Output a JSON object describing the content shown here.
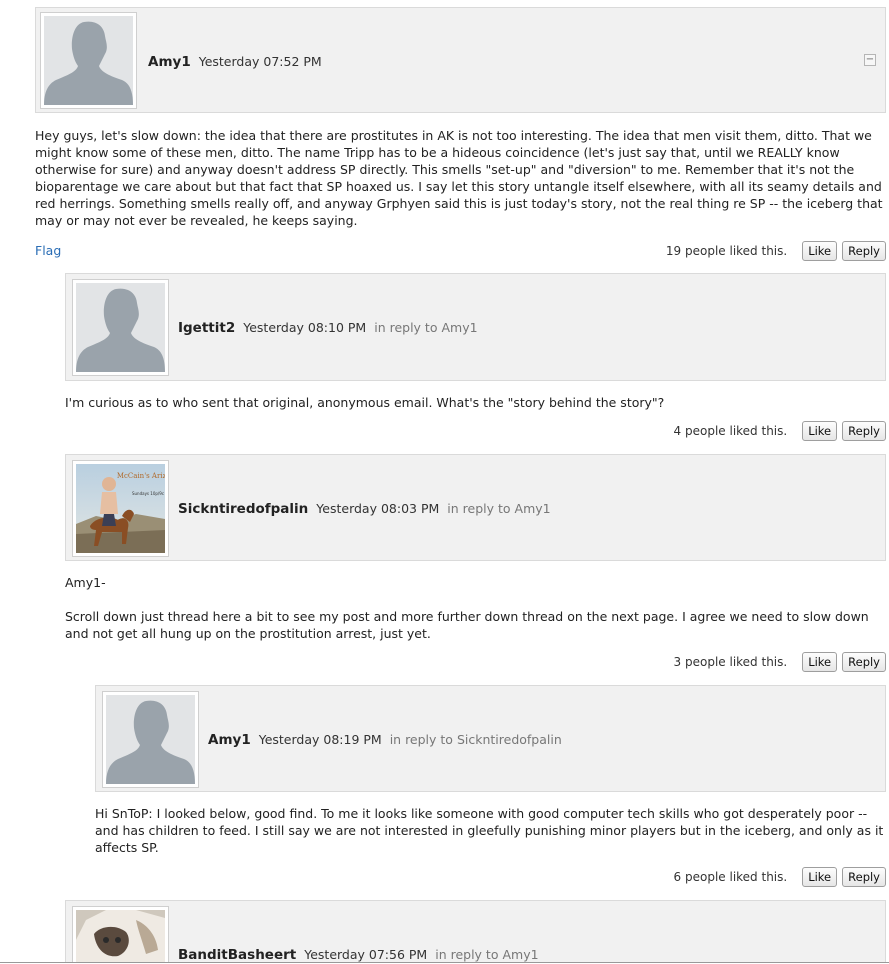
{
  "comments": [
    {
      "author": "Amy1",
      "time": "Yesterday 07:52 PM",
      "reply_to": "",
      "collapse_label": "−",
      "body": [
        "Hey guys, let's slow down: the idea that there are prostitutes in AK is not too interesting. The idea that men visit them, ditto. That we might know some of these men, ditto. The name Tripp has to be a hideous coincidence (let's just say that, until we REALLY know otherwise for sure) and anyway doesn't address SP directly. This smells \"set-up\" and \"diversion\" to me. Remember that it's not the bioparentage we care about but that fact that SP hoaxed us. I say let this story untangle itself elsewhere, with all its seamy details and red herrings. Something smells really off, and anyway Grphyen said this is just today's story, not the real thing re SP -- the iceberg that may or may not ever be revealed, he keeps saying."
      ],
      "flag": "Flag",
      "likes": "19 people liked this.",
      "like_label": "Like",
      "reply_label": "Reply"
    },
    {
      "author": "Igettit2",
      "time": "Yesterday 08:10 PM",
      "reply_prefix": "in reply to",
      "reply_to": "Amy1",
      "body": [
        "I'm curious as to who sent that original, anonymous email. What's the \"story behind the story\"?"
      ],
      "likes": "4 people liked this.",
      "like_label": "Like",
      "reply_label": "Reply"
    },
    {
      "author": "Sickntiredofpalin",
      "time": "Yesterday 08:03 PM",
      "reply_prefix": "in reply to",
      "reply_to": "Amy1",
      "avatar_caption": "McCain's Arizona",
      "avatar_subcaption": "Sundays 10p/9c",
      "body": [
        "Amy1-",
        "Scroll down just thread here a bit to see my post and more further down thread on the next page. I agree we need to slow down and not get all hung up on the prostitution arrest, just yet."
      ],
      "likes": "3 people liked this.",
      "like_label": "Like",
      "reply_label": "Reply"
    },
    {
      "author": "Amy1",
      "time": "Yesterday 08:19 PM",
      "reply_prefix": "in reply to",
      "reply_to": "Sickntiredofpalin",
      "body": [
        "Hi SnToP: I looked below, good find. To me it looks like someone with good computer tech skills who got desperately poor -- and has children to feed. I still say we are not interested in gleefully punishing minor players but in the iceberg, and only as it affects SP."
      ],
      "likes": "6 people liked this.",
      "like_label": "Like",
      "reply_label": "Reply"
    },
    {
      "author": "BanditBasheert",
      "time": "Yesterday 07:56 PM",
      "reply_prefix": "in reply to",
      "reply_to": "Amy1"
    }
  ],
  "colors": {
    "link": "#2a6db5",
    "header_bg": "#f1f1f1",
    "silhouette": "#9aa3ab"
  }
}
